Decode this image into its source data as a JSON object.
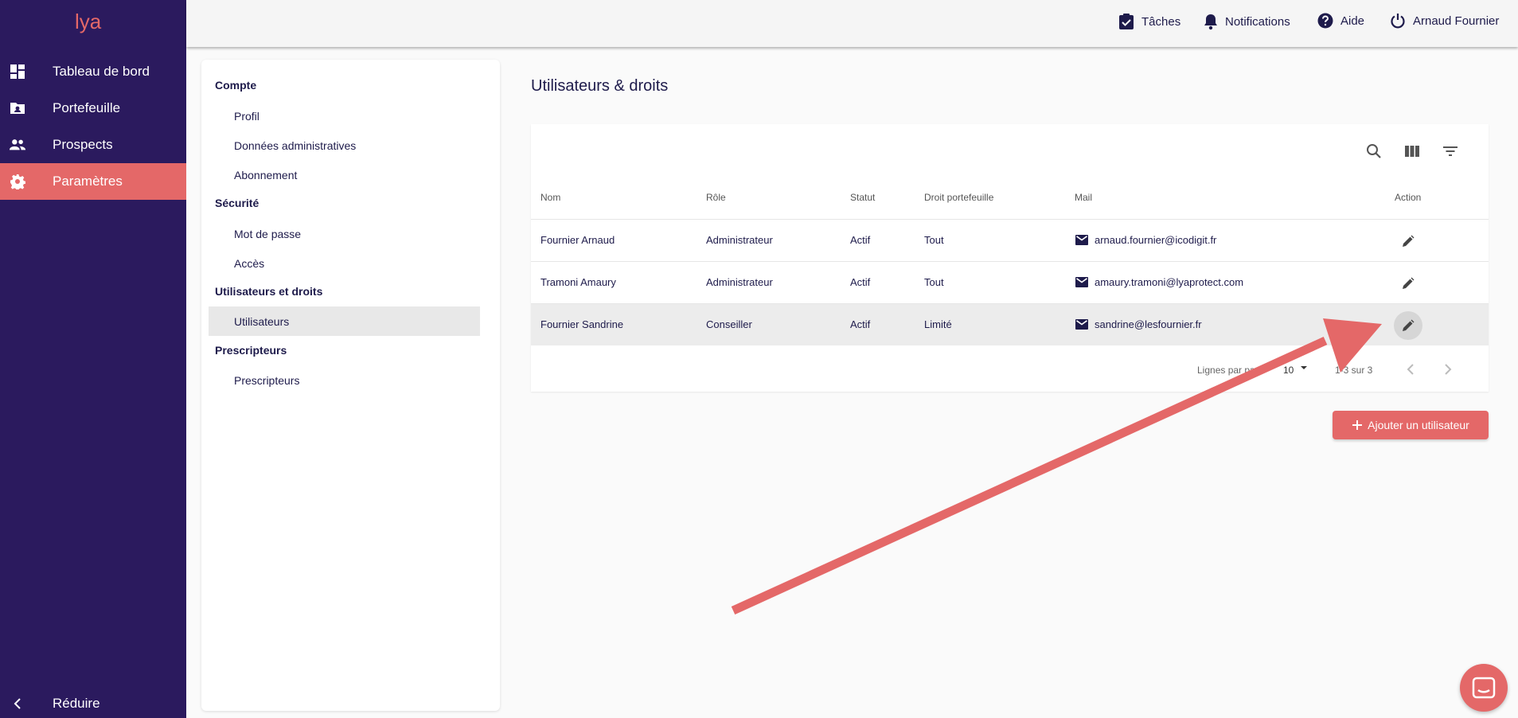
{
  "app": {
    "logo_text": "lya",
    "accent_color": "#e46868",
    "sidebar_color": "#2b1a5e"
  },
  "sidebar": {
    "items": [
      {
        "label": "Tableau de bord",
        "icon": "dashboard-icon"
      },
      {
        "label": "Portefeuille",
        "icon": "folder-account-icon"
      },
      {
        "label": "Prospects",
        "icon": "people-icon"
      },
      {
        "label": "Paramètres",
        "icon": "gear-icon",
        "active": true
      }
    ],
    "collapse_label": "Réduire"
  },
  "topbar": {
    "tasks": "Tâches",
    "notifications": "Notifications",
    "help": "Aide",
    "user": "Arnaud Fournier"
  },
  "settings": {
    "sections": [
      {
        "title": "Compte",
        "items": [
          "Profil",
          "Données administratives",
          "Abonnement"
        ]
      },
      {
        "title": "Sécurité",
        "items": [
          "Mot de passe",
          "Accès"
        ]
      },
      {
        "title": "Utilisateurs et droits",
        "items": [
          "Utilisateurs"
        ]
      },
      {
        "title": "Prescripteurs",
        "items": [
          "Prescripteurs"
        ]
      }
    ],
    "selected": "Utilisateurs"
  },
  "main": {
    "title": "Utilisateurs & droits",
    "columns": [
      "Nom",
      "Rôle",
      "Statut",
      "Droit portefeuille",
      "Mail",
      "Action"
    ],
    "rows": [
      {
        "nom": "Fournier Arnaud",
        "role": "Administrateur",
        "statut": "Actif",
        "droit": "Tout",
        "mail": "arnaud.fournier@icodigit.fr"
      },
      {
        "nom": "Tramoni Amaury",
        "role": "Administrateur",
        "statut": "Actif",
        "droit": "Tout",
        "mail": "amaury.tramoni@lyaprotect.com"
      },
      {
        "nom": "Fournier Sandrine",
        "role": "Conseiller",
        "statut": "Actif",
        "droit": "Limité",
        "mail": "sandrine@lesfournier.fr"
      }
    ],
    "pagination": {
      "rows_per_page_label": "Lignes par page",
      "rows_per_page": "10",
      "range": "1-3 sur 3"
    },
    "add_button": "Ajouter un utilisateur"
  }
}
